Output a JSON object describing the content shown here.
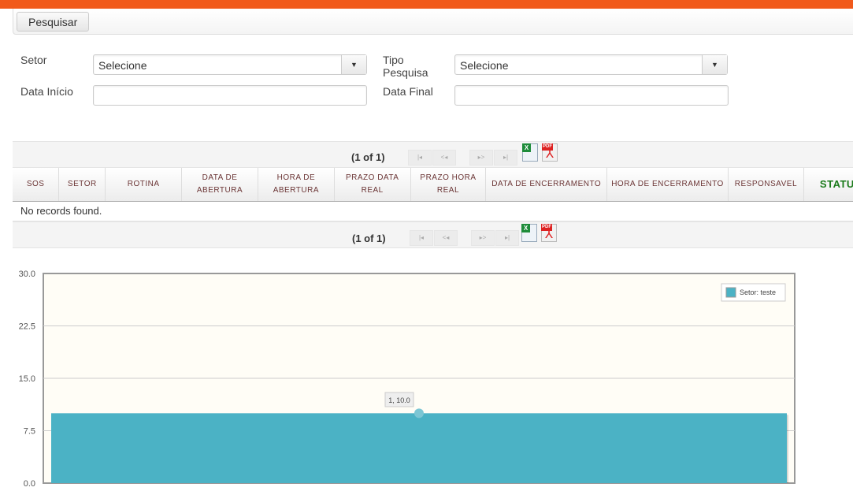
{
  "toolbar": {
    "search_label": "Pesquisar"
  },
  "form": {
    "setor_label": "Setor",
    "setor_value": "Selecione",
    "tipo_label_1": "Tipo",
    "tipo_label_2": "Pesquisa",
    "tipo_value": "Selecione",
    "data_inicio_label": "Data Início",
    "data_inicio_value": "",
    "data_final_label": "Data Final",
    "data_final_value": ""
  },
  "pager": {
    "count": "(1 of 1)",
    "first": "|◂",
    "prev": "<◂",
    "next": "▸>",
    "last": "▸|",
    "excel": "X",
    "pdf": "PDF"
  },
  "table": {
    "columns": [
      "SOS",
      "SETOR",
      "ROTINA",
      "DATA DE ABERTURA",
      "HORA DE ABERTURA",
      "PRAZO DATA REAL",
      "PRAZO HORA REAL",
      "DATA DE ENCERRAMENTO",
      "HORA DE ENCERRAMENTO",
      "RESPONSAVEL",
      "STATUS"
    ],
    "empty": "No records found."
  },
  "chart_data": {
    "type": "bar",
    "categories": [
      "1"
    ],
    "series": [
      {
        "name": "Setor: teste",
        "values": [
          10.0
        ],
        "color": "#4bb2c5"
      }
    ],
    "ylim": [
      0,
      30
    ],
    "yticks": [
      "0.0",
      "7.5",
      "15.0",
      "22.5",
      "30.0"
    ],
    "tooltip": "1, 10.0",
    "legend_position": "top-right",
    "grid": true
  }
}
